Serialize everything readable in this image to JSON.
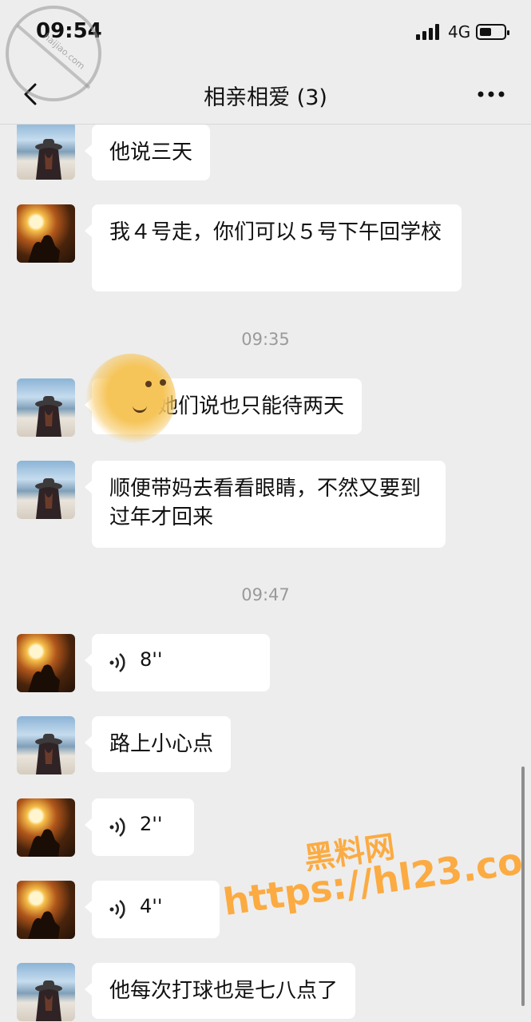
{
  "status_bar": {
    "time": "09:54",
    "network": "4G"
  },
  "header": {
    "title": "相亲相爱 (3)"
  },
  "messages": [
    {
      "sender": "girl",
      "text": "他说三天"
    },
    {
      "sender": "sun",
      "text": "我４号走，你们可以５号下午回学校"
    },
    {
      "type": "time",
      "text": "09:35"
    },
    {
      "sender": "girl",
      "text": "她们说也只能待两天"
    },
    {
      "sender": "girl",
      "text": "顺便带妈去看看眼睛，不然又要到过年才回来"
    },
    {
      "type": "time",
      "text": "09:47"
    },
    {
      "sender": "sun",
      "type": "voice",
      "duration": "8''"
    },
    {
      "sender": "girl",
      "text": "路上小心点"
    },
    {
      "sender": "sun",
      "type": "voice",
      "duration": "2''"
    },
    {
      "sender": "sun",
      "type": "voice",
      "duration": "4''"
    },
    {
      "sender": "girl",
      "text": "他每次打球也是七八点了"
    }
  ],
  "watermark": {
    "stamp_text": "海社区 haijiao.com",
    "line1": "黑料网",
    "line2": "https://hl23.co"
  }
}
